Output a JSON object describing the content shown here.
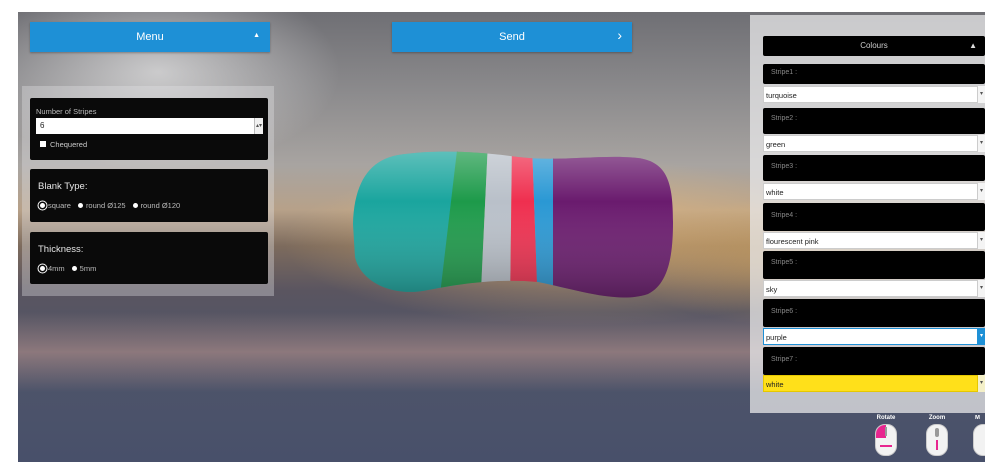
{
  "top_buttons": {
    "menu_label": "Menu",
    "menu_arrow": "▲",
    "send_label": "Send",
    "send_arrow": "›"
  },
  "left_panel": {
    "number_of_stripes_label": "Number of Stripes",
    "number_of_stripes_value": "6",
    "chequered_label": "Chequered",
    "chequered_checked": false,
    "blank_type": {
      "title": "Blank Type:",
      "options": [
        "square",
        "round Ø125",
        "round Ø120"
      ],
      "selected": "square"
    },
    "thickness": {
      "title": "Thickness:",
      "options": [
        "4mm",
        "5mm"
      ],
      "selected": "4mm"
    }
  },
  "right_panel": {
    "colours_title": "Colours",
    "colours_arrow": "▲",
    "stripes": [
      {
        "label": "Stripe1 :",
        "value": "turquoise"
      },
      {
        "label": "Stripe2 :",
        "value": "green"
      },
      {
        "label": "Stripe3 :",
        "value": "white"
      },
      {
        "label": "Stripe4 :",
        "value": "flourescent pink"
      },
      {
        "label": "Stripe5 :",
        "value": "sky"
      },
      {
        "label": "Stripe6 :",
        "value": "purple"
      },
      {
        "label": "Stripe7 :",
        "value": "white"
      }
    ]
  },
  "controls": {
    "rotate_label": "Rotate",
    "zoom_label": "Zoom",
    "third_label": "M"
  },
  "model": {
    "stripe_colors": [
      "#1aa59e",
      "#1d9a4a",
      "#b9c0c9",
      "#ef2f4f",
      "#2a98d4",
      "#6a1b6e"
    ]
  },
  "colors": {
    "accent_button": "#1e90d6",
    "panel_dark": "#0a0a0a",
    "highlight_field": "#ffe01a",
    "active_field_border": "#1e90d6",
    "mouse_accent": "#e8258f"
  }
}
